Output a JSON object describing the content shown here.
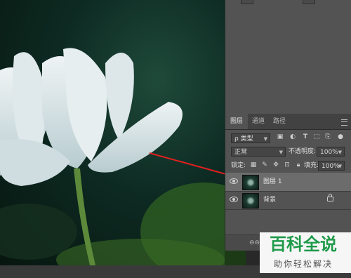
{
  "canvas": {
    "image_icon": "white-lotus-photo"
  },
  "layers_panel": {
    "tabs": [
      {
        "label": "图层",
        "active": true
      },
      {
        "label": "通道",
        "active": false
      },
      {
        "label": "路径",
        "active": false
      }
    ],
    "filter": {
      "label": "ρ 类型",
      "icons": [
        "image-filter-icon",
        "adjustment-filter-icon",
        "text-filter-icon",
        "shape-filter-icon",
        "smart-object-filter-icon"
      ]
    },
    "blend_mode": "正常",
    "opacity_label": "不透明度:",
    "opacity_value": "100%",
    "lock_label": "锁定:",
    "lock_icons": [
      "lock-transparent-icon",
      "lock-paint-icon",
      "lock-position-icon",
      "lock-artboard-icon",
      "lock-all-icon"
    ],
    "fill_label": "填充:",
    "fill_value": "100%",
    "layers": [
      {
        "name": "图层 1",
        "selected": true,
        "visible": true,
        "locked": false
      },
      {
        "name": "背景",
        "selected": false,
        "visible": true,
        "locked": true
      }
    ],
    "footer_icons": [
      "link-layers-icon"
    ]
  },
  "watermark": {
    "logo_text": "百科全说",
    "sub_text": "助你轻松解决"
  },
  "colors": {
    "panel_bg": "#535353",
    "selected_row": "#6c6c6c",
    "arrow": "#e02020",
    "watermark_green": "#1f9a4a"
  }
}
